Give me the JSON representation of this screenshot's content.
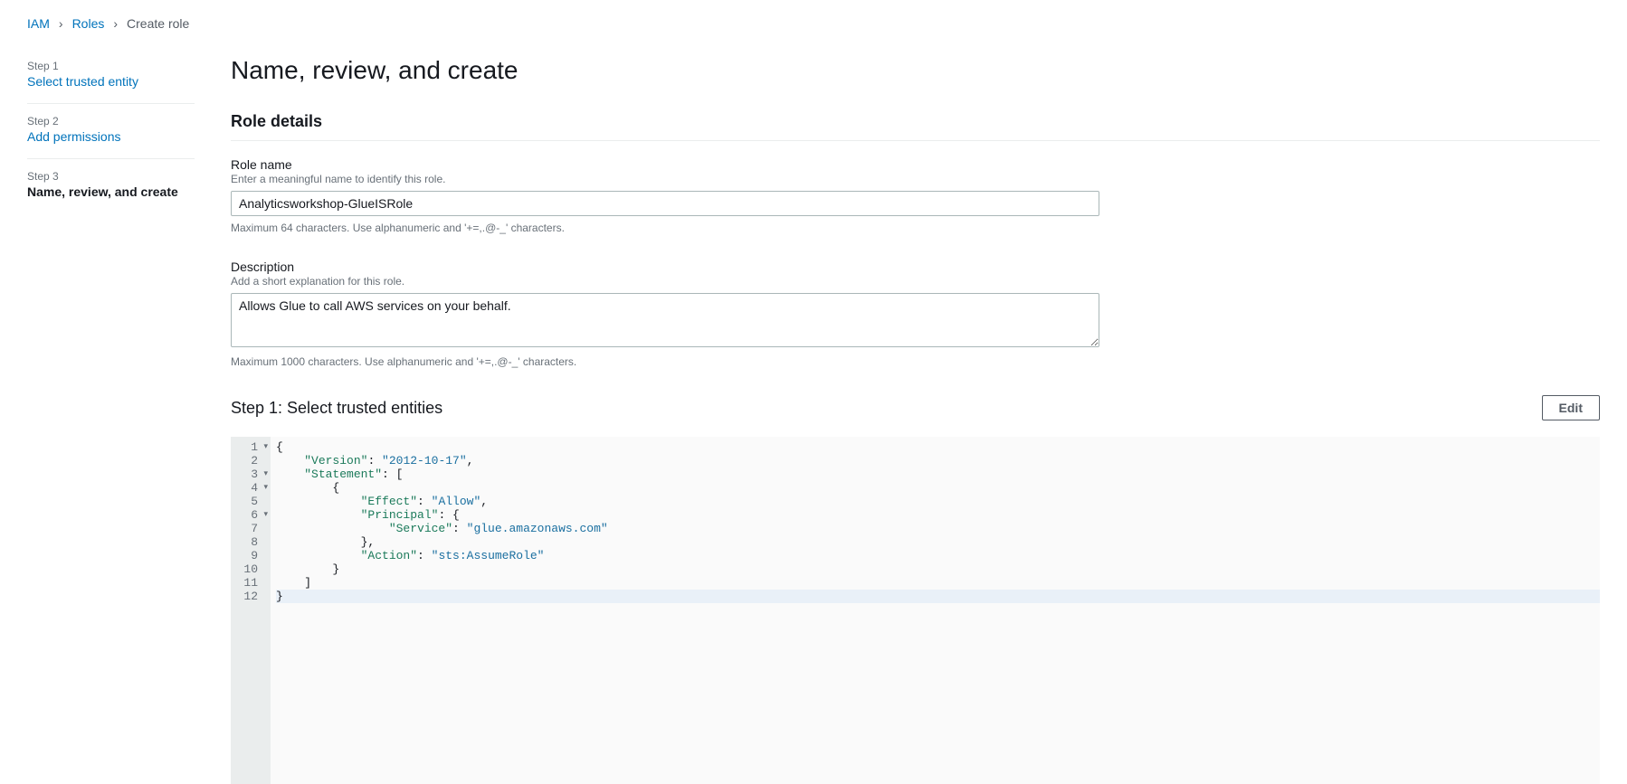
{
  "breadcrumb": {
    "iam": "IAM",
    "roles": "Roles",
    "current": "Create role"
  },
  "sidebar": {
    "steps": [
      {
        "num": "Step 1",
        "title": "Select trusted entity"
      },
      {
        "num": "Step 2",
        "title": "Add permissions"
      },
      {
        "num": "Step 3",
        "title": "Name, review, and create"
      }
    ]
  },
  "page_title": "Name, review, and create",
  "role_details": {
    "section_title": "Role details",
    "name_label": "Role name",
    "name_help": "Enter a meaningful name to identify this role.",
    "name_value": "Analyticsworkshop-GlueISRole",
    "name_hint": "Maximum 64 characters. Use alphanumeric and '+=,.@-_' characters.",
    "desc_label": "Description",
    "desc_help": "Add a short explanation for this role.",
    "desc_value": "Allows Glue to call AWS services on your behalf.",
    "desc_hint": "Maximum 1000 characters. Use alphanumeric and '+=,.@-_' characters."
  },
  "trusted_entities": {
    "title": "Step 1: Select trusted entities",
    "edit_label": "Edit",
    "policy": {
      "Version": "2012-10-17",
      "Statement": [
        {
          "Effect": "Allow",
          "Principal": {
            "Service": "glue.amazonaws.com"
          },
          "Action": "sts:AssumeRole"
        }
      ]
    },
    "gutter_lines": [
      "1",
      "2",
      "3",
      "4",
      "5",
      "6",
      "7",
      "8",
      "9",
      "10",
      "11",
      "12"
    ],
    "fold_lines": [
      1,
      3,
      4,
      6
    ]
  }
}
